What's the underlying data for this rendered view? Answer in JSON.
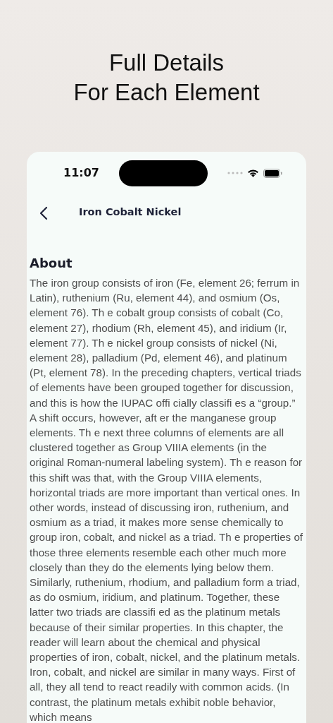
{
  "headline_lines": [
    "Full Details",
    "For Each Element"
  ],
  "status_bar": {
    "time": "11:07"
  },
  "nav": {
    "title": "Iron Cobalt Nickel"
  },
  "section": {
    "heading": "About",
    "body": "The iron group consists of iron (Fe, element 26; ferrum in Latin), ruthenium (Ru, element 44), and osmium (Os, element 76). Th e cobalt group consists of cobalt (Co, element 27), rhodium (Rh, element 45), and iridium (Ir, element 77). Th e nickel group consists of nickel (Ni, element 28), palladium (Pd, element 46), and platinum (Pt, element 78). In the preceding chapters, vertical triads of elements have been grouped together for discussion, and this is how the IUPAC offi cially classifi es a “group.” A shift occurs, however, aft er the manganese group elements. Th e next three columns of elements are all clustered together as Group VIIIA elements (in the original Roman-numeral labeling system). Th e reason for this shift was that, with the Group VIIIA elements, horizontal triads are more important than vertical ones. In other words, instead of discussing iron, ruthenium, and osmium as a triad, it makes more sense chemically to group iron, cobalt, and nickel as a triad. Th e properties of those three elements resemble each other much more closely than they do the elements lying below them. Similarly, ruthenium, rhodium, and palladium form a triad, as do osmium, iridium, and platinum. Together, these latter two triads are classifi ed as the platinum metals because of their similar properties. In this chapter, the reader will learn about the chemical and physical properties of iron, cobalt, nickel, and the platinum metals. Iron, cobalt, and nickel are similar in many ways. First of all, they all tend to react readily with common acids. (In contrast, the platinum metals exhibit noble behavior, which means"
  }
}
